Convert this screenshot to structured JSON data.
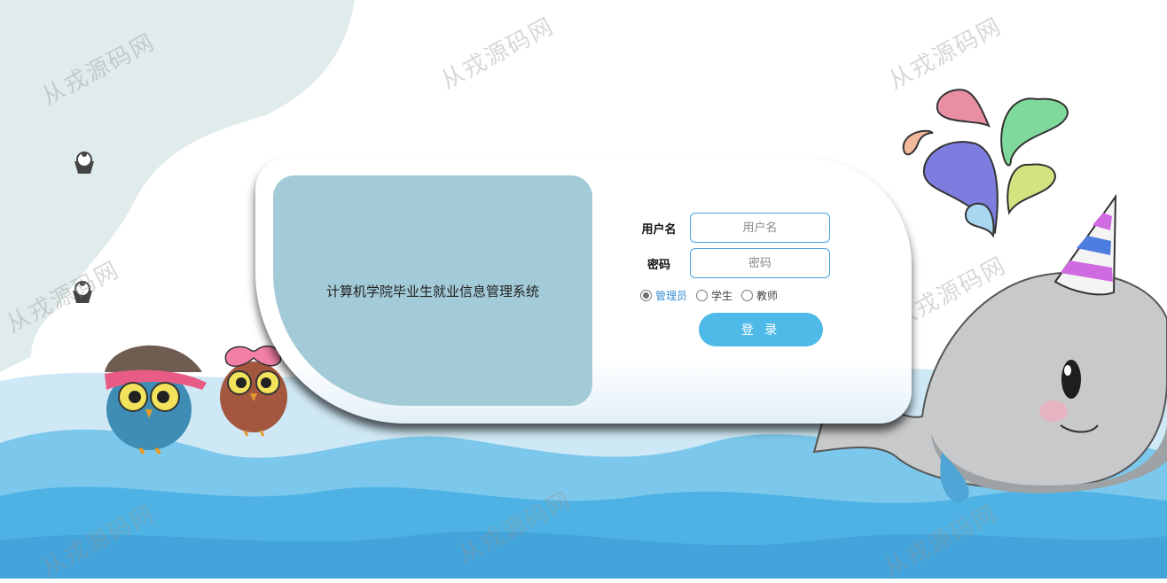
{
  "watermark_text": "从戎源码网",
  "system_title": "计算机学院毕业生就业信息管理系统",
  "form": {
    "username_label": "用户名",
    "username_placeholder": "用户名",
    "password_label": "密码",
    "password_placeholder": "密码",
    "roles": [
      {
        "label": "管理员",
        "selected": true
      },
      {
        "label": "学生",
        "selected": false
      },
      {
        "label": "教师",
        "selected": false
      }
    ],
    "login_button": "登 录"
  },
  "colors": {
    "accent": "#4fb9e7",
    "title_panel": "#a3cad7",
    "input_border": "#4aa3df",
    "selected_role": "#3a8fd4",
    "sky": "#dfeceb",
    "water": "#4eb3e4"
  },
  "illustrations": [
    "cloud",
    "owl-with-cap",
    "owl-with-bow",
    "whale-with-party-hat",
    "water-splash-drops",
    "cupcake-icon",
    "waves"
  ]
}
